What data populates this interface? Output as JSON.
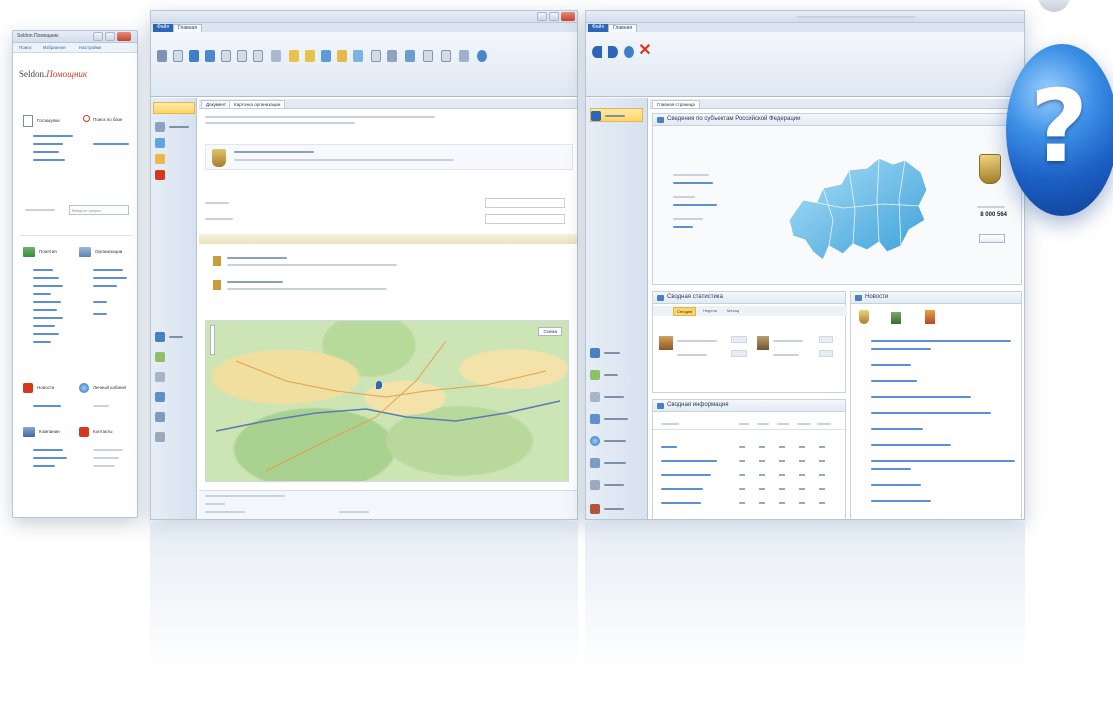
{
  "left_window": {
    "title": "Seldon.Помощник",
    "toolbar_items": [
      "Поиск",
      "Избранное",
      "Настройки"
    ],
    "brand_name": "Seldon.",
    "brand_accent": "Помощник",
    "sections": [
      {
        "title": "Госзакупки"
      },
      {
        "title": "Поиск по базе"
      },
      {
        "title": "Понятия"
      },
      {
        "title": "Организации"
      },
      {
        "title": "Новости"
      },
      {
        "title": "Личный кабинет"
      },
      {
        "title": "Компании"
      },
      {
        "title": "Контакты"
      }
    ],
    "search_placeholder": "Введите запрос"
  },
  "middle_window": {
    "file_tab": "Файл",
    "ribbon_tabs": [
      "Главная"
    ],
    "doc_tabs": [
      "Документ",
      "Карточка организации"
    ],
    "map_button": "Схема"
  },
  "right_window": {
    "file_tab": "Файл",
    "ribbon_tabs": [
      "Главная"
    ],
    "close_icon_color": "#d9361f",
    "doc_tab": "Главная страница",
    "top_panel_title": "Сведения по субъектам Российской Федерации",
    "stats_panel_title": "Сводная статистика",
    "news_panel_title": "Новости",
    "table_panel_title": "Сводная информация",
    "counter_value": "8 000 564",
    "stats_tabs": [
      "Сегодня",
      "Неделя",
      "Месяц"
    ]
  },
  "colors": {
    "accent_blue": "#2b66b8",
    "brand_red": "#d9361f",
    "map_blue": "#6fc6ef",
    "help_icon": "#1c5fc4"
  },
  "icons": [
    "question-mark-icon",
    "russia-map-image",
    "coat-of-arms-icon",
    "route-map-image"
  ]
}
